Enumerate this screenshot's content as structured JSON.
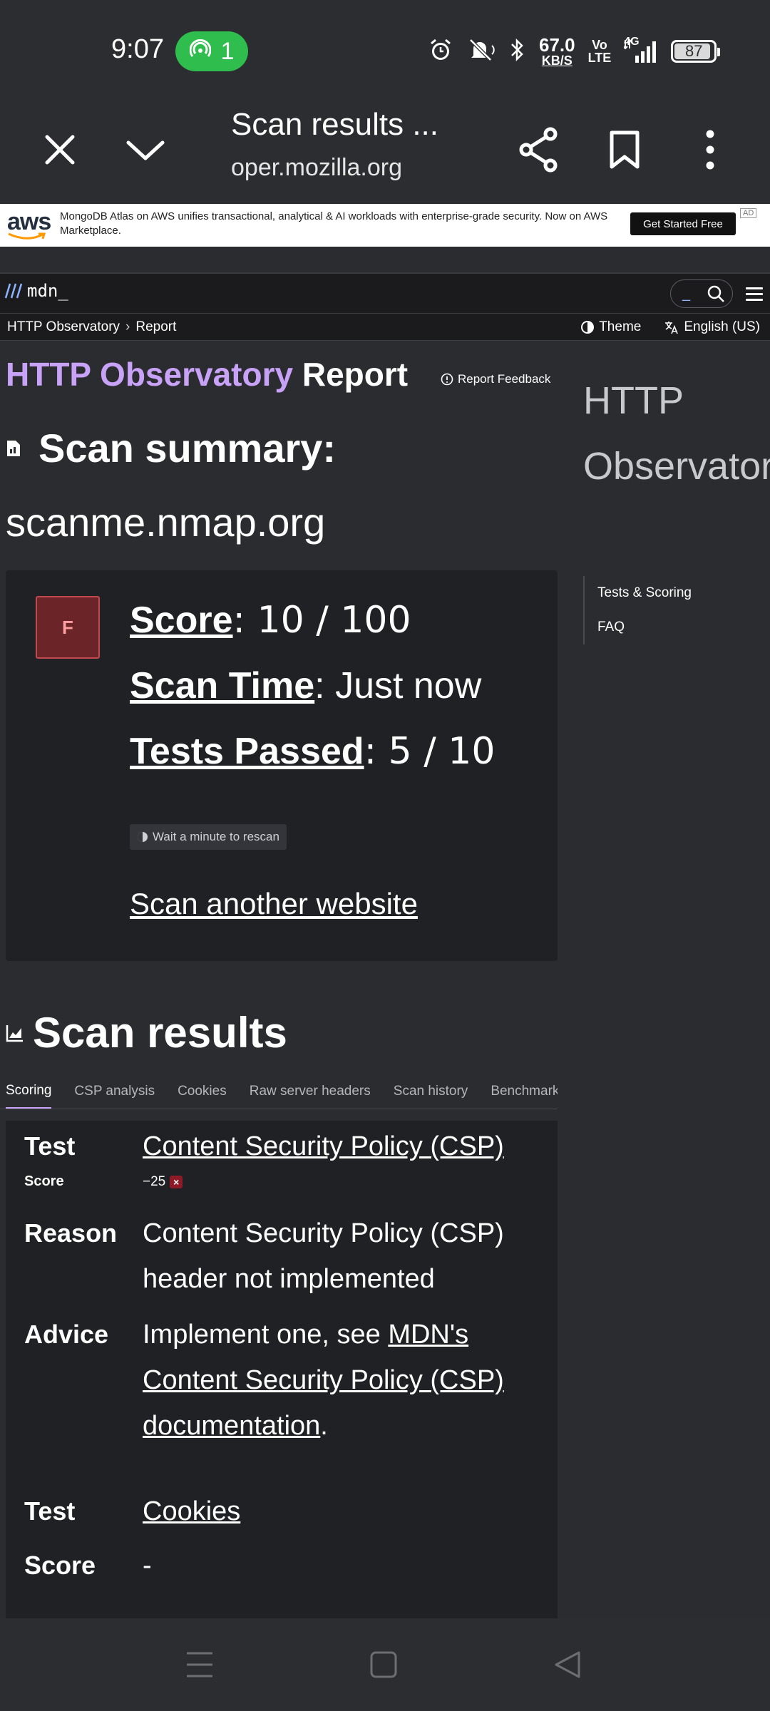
{
  "status_bar": {
    "time": "9:07",
    "hotspot_count": "1",
    "net_speed_value": "67.0",
    "net_speed_unit": "KB/S",
    "volte_line1": "Vo",
    "volte_line2": "LTE",
    "network_type": "4G",
    "battery": "87",
    "colors": {
      "hotspot_bg": "#2fbe4e"
    }
  },
  "browser": {
    "page_title": "Scan results ...",
    "url": "oper.mozilla.org"
  },
  "ad": {
    "logo": "aws",
    "text": "MongoDB Atlas on AWS unifies transactional, analytical & AI workloads with enterprise-grade security. Now on AWS Marketplace.",
    "button": "Get Started Free",
    "tag": "AD"
  },
  "mdn": {
    "logo_text": "mdn_",
    "breadcrumb": [
      "HTTP Observatory",
      "Report"
    ],
    "theme_label": "Theme",
    "language_label": "English (US)"
  },
  "report": {
    "title_highlight": "HTTP Observatory",
    "title_rest": "Report",
    "feedback_label": "Report Feedback",
    "summary_heading": "Scan summary:",
    "host": "scanme.nmap.org",
    "grade": "F",
    "score_label": "Score",
    "score_value": ": 10 / 100",
    "scan_time_label": "Scan Time",
    "scan_time_value": ": Just now",
    "tests_passed_label": "Tests Passed",
    "tests_passed_value": ": 5 /  10",
    "rescan_label": "Wait a minute to rescan",
    "scan_another": "Scan another website",
    "results_heading": "Scan results",
    "accent_color": "#c8a2f7"
  },
  "tabs": [
    "Scoring",
    "CSP analysis",
    "Cookies",
    "Raw server headers",
    "Scan history",
    "Benchmark c"
  ],
  "results": {
    "test1_label": "Test",
    "test1_value": "Content Security Policy (CSP)",
    "score1_label": "Score",
    "score1_value": "−25",
    "reason_label": "Reason",
    "reason_value": "Content Security Policy (CSP) header not implemented",
    "advice_label": "Advice",
    "advice_prefix": "Implement one, see ",
    "advice_link": "MDN's Content Security Policy (CSP) documentation",
    "advice_suffix": ".",
    "test2_label": "Test",
    "test2_value": "Cookies",
    "score2_label": "Score",
    "score2_value": "-"
  },
  "toc": {
    "title": "HTTP Observatory",
    "items": [
      "Tests & Scoring",
      "FAQ"
    ]
  }
}
